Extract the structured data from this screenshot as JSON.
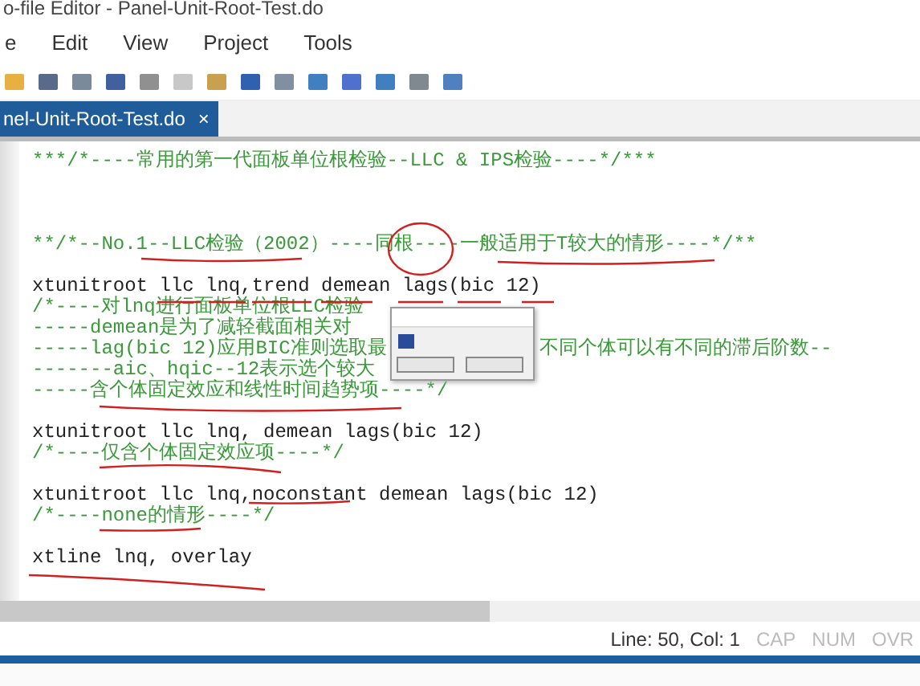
{
  "window": {
    "title": "o-file Editor - Panel-Unit-Root-Test.do"
  },
  "menu": [
    "e",
    "Edit",
    "View",
    "Project",
    "Tools"
  ],
  "tabs": [
    {
      "label": "nel-Unit-Root-Test.do",
      "selected": true,
      "close": "×"
    }
  ],
  "editor": {
    "lines": [
      {
        "kind": "comment",
        "text": "***/*----常用的第一代面板单位根检验--LLC & IPS检验----*/***"
      },
      {
        "kind": "blank"
      },
      {
        "kind": "blank"
      },
      {
        "kind": "blank"
      },
      {
        "kind": "comment",
        "text": "**/*--No.1--LLC检验（2002）----同根----一般适用于T较大的情形----*/**"
      },
      {
        "kind": "blank"
      },
      {
        "kind": "code",
        "text": "xtunitroot llc lnq,trend demean lags(bic 12)"
      },
      {
        "kind": "comment",
        "text": "/*----对lnq进行面板单位根LLC检验"
      },
      {
        "kind": "comment",
        "text": "-----demean是为了减轻截面相关对"
      },
      {
        "kind": "comment",
        "text": "-----lag(bic 12)应用BIC准则选取最",
        "tail": "不同个体可以有不同的滞后阶数--"
      },
      {
        "kind": "comment",
        "text": "-------aic、hqic--12表示选个较大"
      },
      {
        "kind": "comment",
        "text": "-----含个体固定效应和线性时间趋势项----*/"
      },
      {
        "kind": "blank"
      },
      {
        "kind": "code",
        "text": "xtunitroot llc lnq, demean lags(bic 12)"
      },
      {
        "kind": "comment",
        "text": "/*----仅含个体固定效应项----*/"
      },
      {
        "kind": "blank"
      },
      {
        "kind": "code",
        "text": "xtunitroot llc lnq,noconstant demean lags(bic 12)"
      },
      {
        "kind": "comment",
        "text": "/*----none的情形----*/"
      },
      {
        "kind": "blank"
      },
      {
        "kind": "code",
        "text": "xtline lnq, overlay"
      }
    ]
  },
  "status_bar": {
    "position": "Line: 50, Col: 1",
    "indicators": [
      {
        "label": "CAP",
        "on": false
      },
      {
        "label": "NUM",
        "on": false
      },
      {
        "label": "OVR",
        "on": false
      }
    ]
  }
}
